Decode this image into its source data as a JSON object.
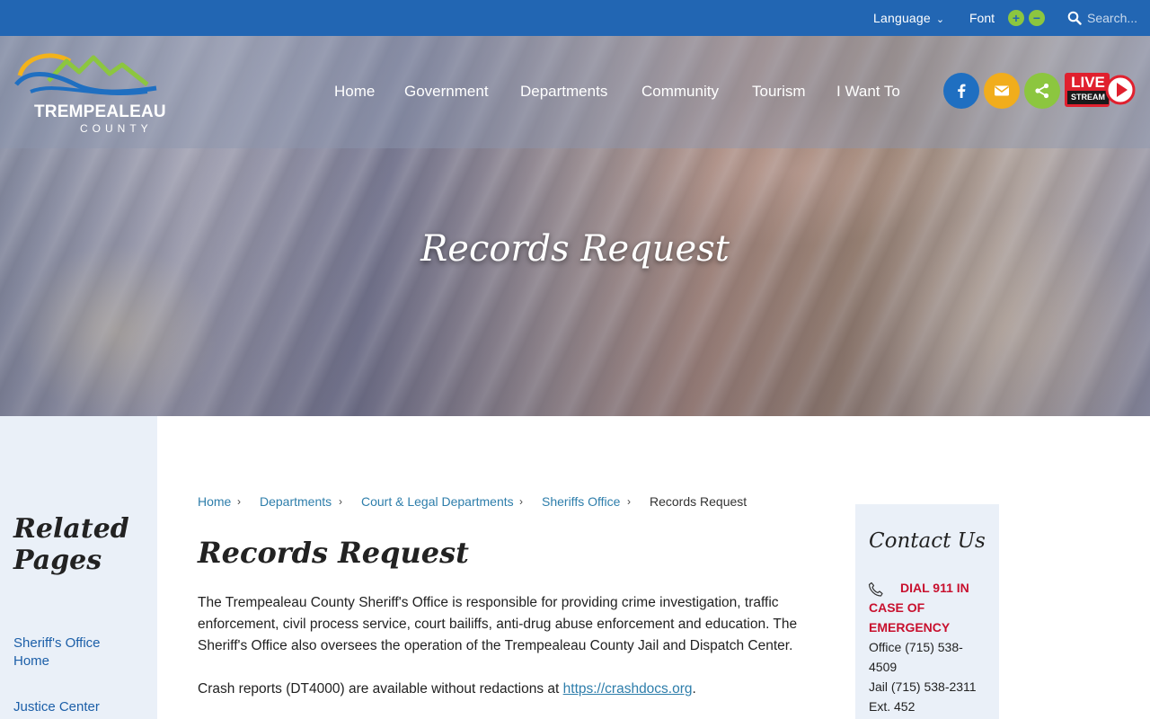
{
  "topbar": {
    "language_label": "Language",
    "font_label": "Font",
    "font_plus": "+",
    "font_minus": "−",
    "search_placeholder": "Search..."
  },
  "site": {
    "brand_name": "TREMPEALEAU",
    "brand_sub": "COUNTY"
  },
  "nav": {
    "items": [
      "Home",
      "Government",
      "Departments",
      "Community",
      "Tourism",
      "I Want To"
    ]
  },
  "social": {
    "facebook_color": "#1f6fc1",
    "email_color": "#f1ad1c",
    "share_color": "#8cc63f",
    "live_text": "LIVE",
    "live_sub": "STREAM",
    "live_color": "#e0202e"
  },
  "hero": {
    "title": "Records Request"
  },
  "sidebar": {
    "heading": "Related Pages",
    "links": [
      "Sheriff's Office Home",
      "Justice Center"
    ]
  },
  "breadcrumb": {
    "items": [
      "Home",
      "Departments",
      "Court & Legal Departments",
      "Sheriffs Office"
    ],
    "current": "Records Request"
  },
  "main": {
    "title": "Records Request",
    "paragraph1": "The Trempealeau County Sheriff's Office is responsible for providing crime investigation, traffic enforcement, civil process service, court bailiffs, anti-drug abuse enforcement and education. The Sheriff's Office also oversees the operation of the Trempealeau County Jail and Dispatch Center.",
    "paragraph2_prefix": "Crash reports (DT4000) are available without redactions at ",
    "paragraph2_link": "https://crashdocs.org",
    "paragraph2_suffix": "."
  },
  "contact": {
    "heading": "Contact Us",
    "emergency": "DIAL 911 IN CASE OF EMERGENCY",
    "office": "Office  (715) 538-4509",
    "jail": "Jail (715) 538-2311 Ext. 452"
  },
  "colors": {
    "topbar": "#2266b3",
    "link": "#2e7eab",
    "emergency_red": "#c8102e",
    "panel_bg": "#eaf0f8"
  }
}
